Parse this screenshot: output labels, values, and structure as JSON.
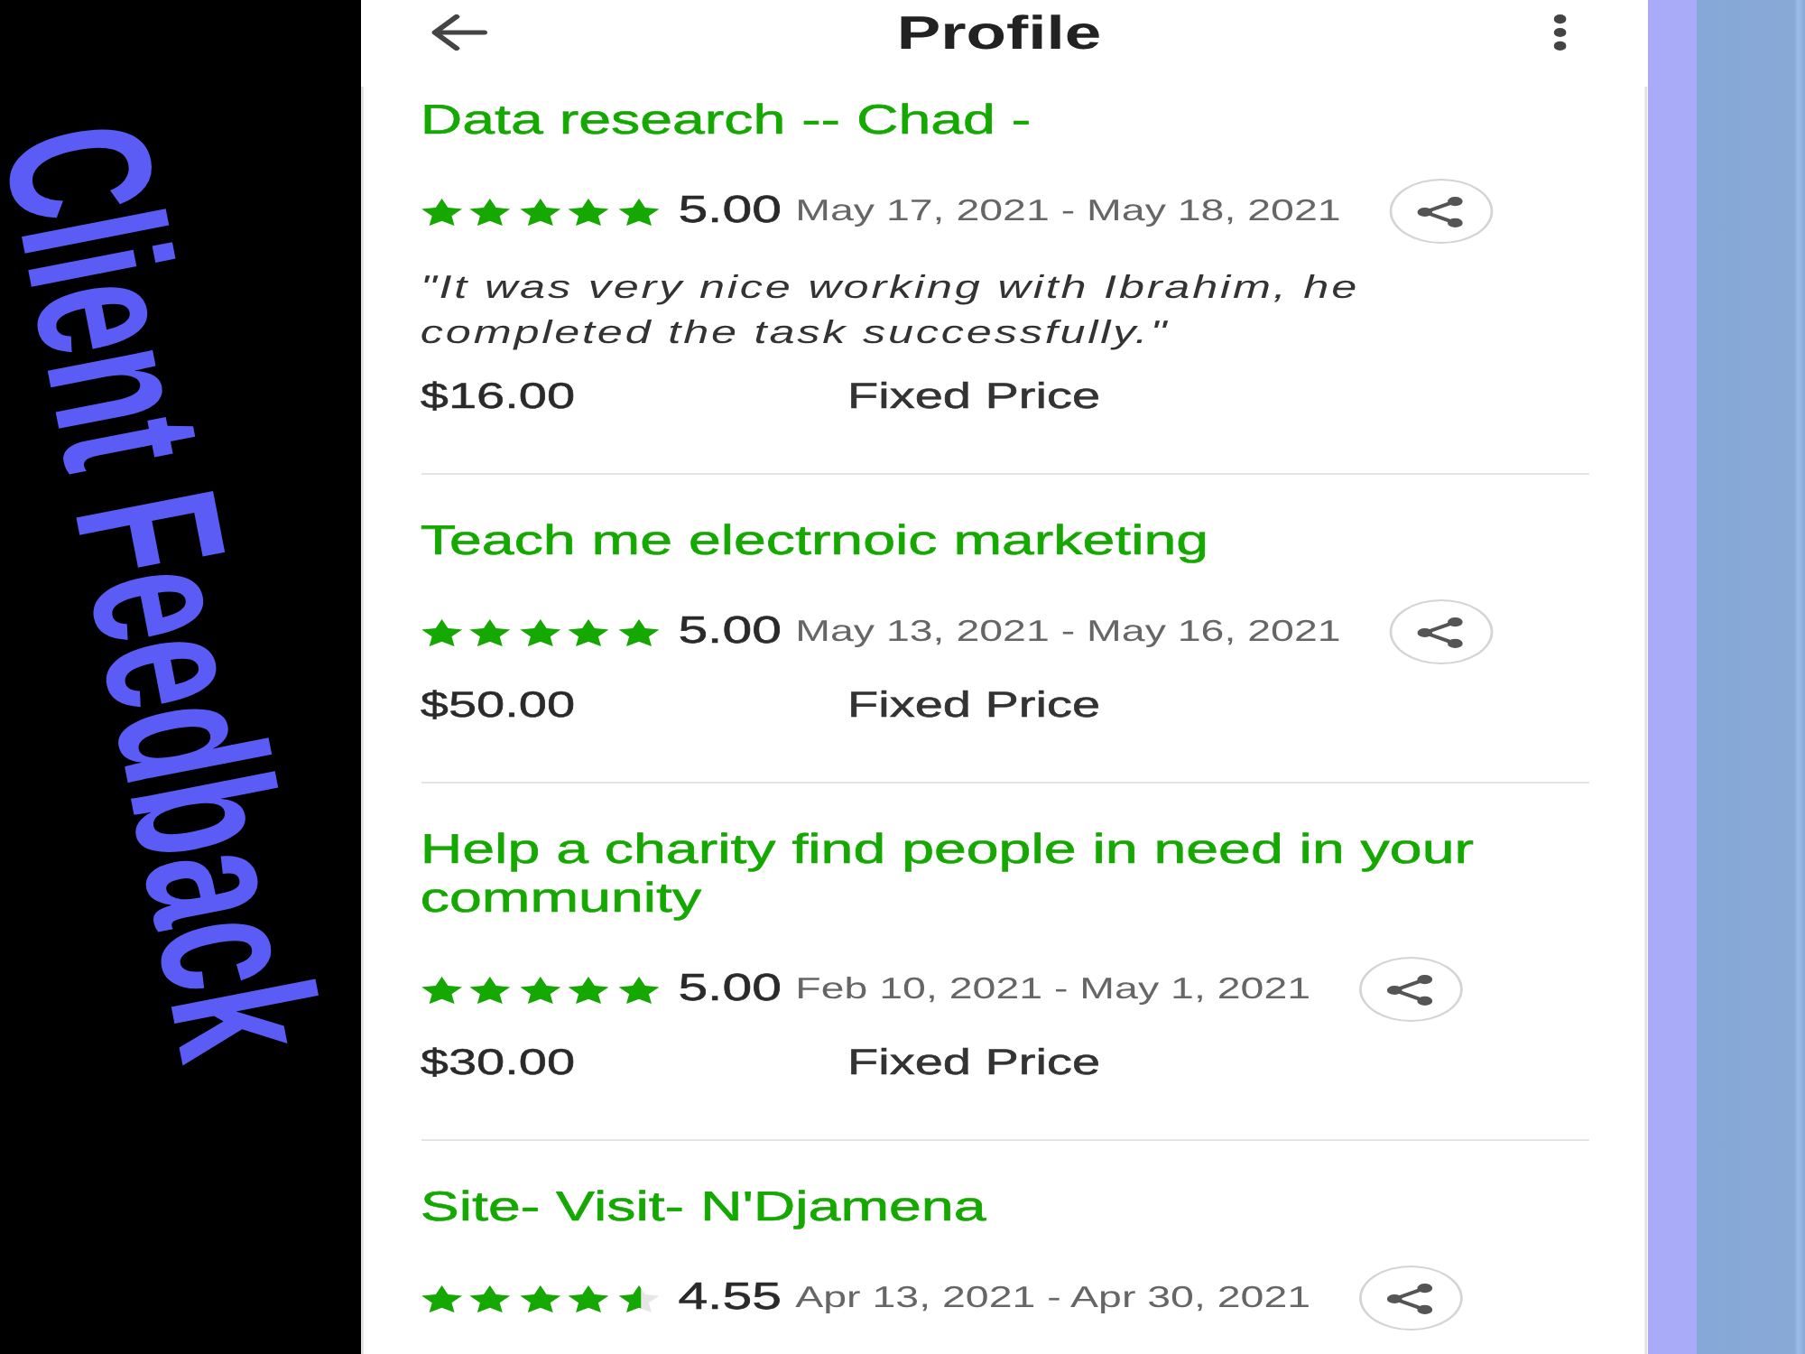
{
  "banner": {
    "title": "Client Feedback"
  },
  "header": {
    "title": "Profile"
  },
  "jobs": [
    {
      "title": "Data research -- Chad -",
      "stars": 5,
      "rating": "5.00",
      "dates": "May 17, 2021 - May 18, 2021",
      "comment": "\"It was very nice working with Ibrahim, he completed the task successfully.\"",
      "amount": "$16.00",
      "price_type": "Fixed Price"
    },
    {
      "title": "Teach me electrnoic marketing",
      "stars": 5,
      "rating": "5.00",
      "dates": "May 13, 2021 - May 16, 2021",
      "amount": "$50.00",
      "price_type": "Fixed Price"
    },
    {
      "title": "Help a charity find people in need in your community",
      "stars": 5,
      "rating": "5.00",
      "dates": "Feb 10, 2021 - May 1, 2021",
      "amount": "$30.00",
      "price_type": "Fixed Price"
    },
    {
      "title": "Site- Visit- N'Djamena",
      "stars": 4.55,
      "rating": "4.55",
      "dates": "Apr 13, 2021 - Apr 30, 2021"
    }
  ]
}
